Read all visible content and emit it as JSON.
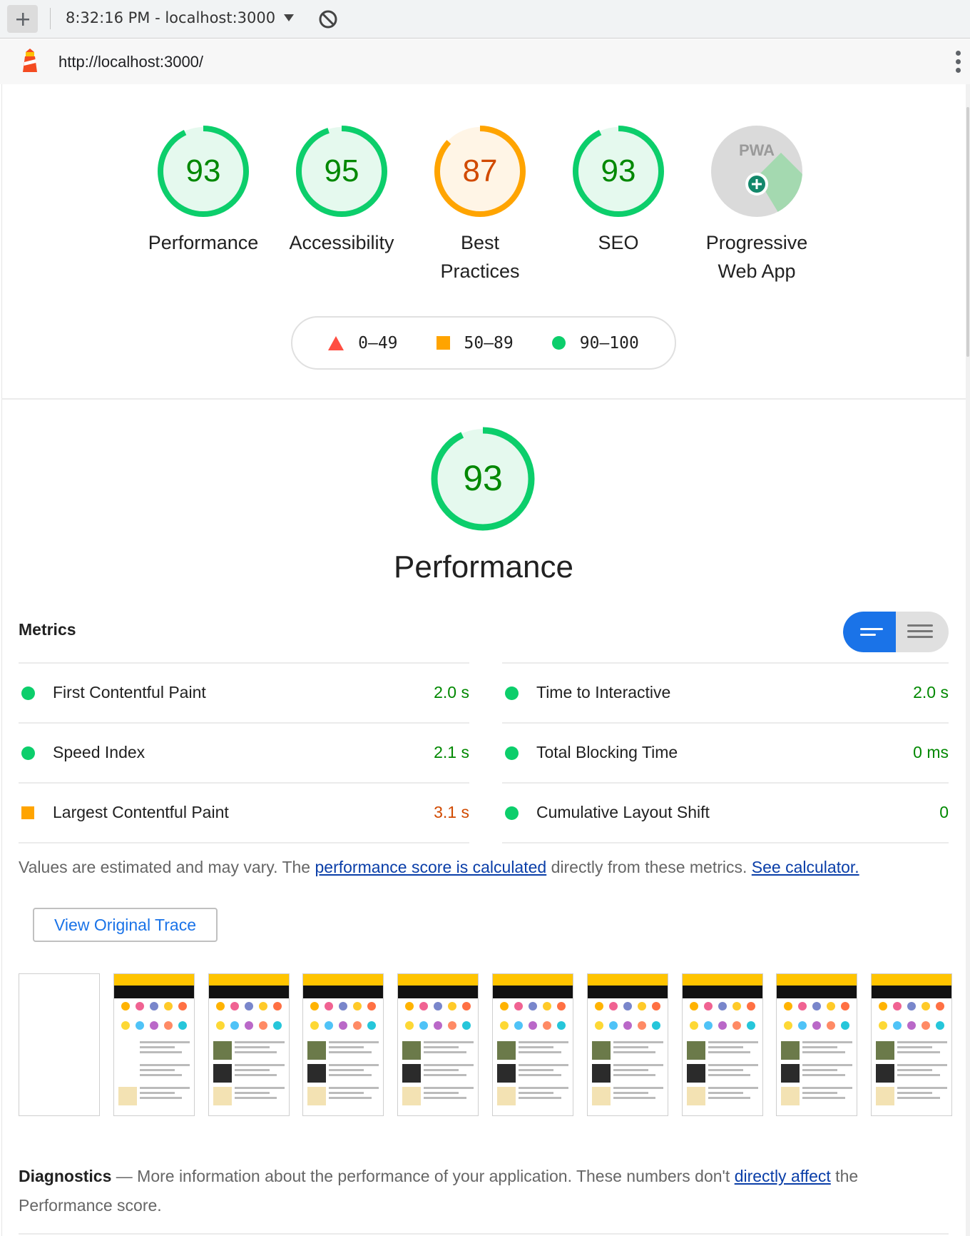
{
  "toolbar": {
    "session_label": "8:32:16 PM - localhost:3000"
  },
  "urlbar": {
    "url": "http://localhost:3000/"
  },
  "categories": [
    {
      "score": 93,
      "label": "Performance",
      "status": "pass"
    },
    {
      "score": 95,
      "label": "Accessibility",
      "status": "pass"
    },
    {
      "score": 87,
      "label": "Best Practices",
      "status": "average"
    },
    {
      "score": 93,
      "label": "SEO",
      "status": "pass"
    },
    {
      "score": null,
      "label": "Progressive Web App",
      "badge": "PWA",
      "status": "pwa"
    }
  ],
  "legend": {
    "fail": "0–49",
    "average": "50–89",
    "pass": "90–100"
  },
  "performance": {
    "score": 93,
    "title": "Performance",
    "metrics_heading": "Metrics",
    "metrics_left": [
      {
        "name": "First Contentful Paint",
        "value": "2.0 s",
        "status": "pass"
      },
      {
        "name": "Speed Index",
        "value": "2.1 s",
        "status": "pass"
      },
      {
        "name": "Largest Contentful Paint",
        "value": "3.1 s",
        "status": "average"
      }
    ],
    "metrics_right": [
      {
        "name": "Time to Interactive",
        "value": "2.0 s",
        "status": "pass"
      },
      {
        "name": "Total Blocking Time",
        "value": "0 ms",
        "status": "pass"
      },
      {
        "name": "Cumulative Layout Shift",
        "value": "0",
        "status": "pass"
      }
    ],
    "note_prefix": "Values are estimated and may vary. The ",
    "note_link": "performance score is calculated",
    "note_mid": " directly from these metrics.",
    "note_calc_link": "See calculator.",
    "trace_button": "View Original Trace",
    "filmstrip_frames": 10
  },
  "diagnostics": {
    "title": "Diagnostics",
    "dash": " — ",
    "text_prefix": "More information about the performance of your application. These numbers don't ",
    "link": "directly affect",
    "text_suffix": " the Performance score."
  },
  "colors": {
    "pass": "#0cce6b",
    "pass_text": "#008800",
    "average": "#ffa400",
    "average_text": "#d14a00",
    "fail": "#ff4e42",
    "pass_bg": "#e5f9ee",
    "average_bg": "#fff5e6",
    "accent": "#1a73e8"
  },
  "icons": {
    "add": "plus-icon",
    "dropdown": "caret-down-icon",
    "clear": "block-icon",
    "logo": "lighthouse-logo-icon",
    "menu": "kebab-menu-icon",
    "view_toggle_on": "list-view-icon",
    "view_toggle_off": "detail-view-icon"
  }
}
